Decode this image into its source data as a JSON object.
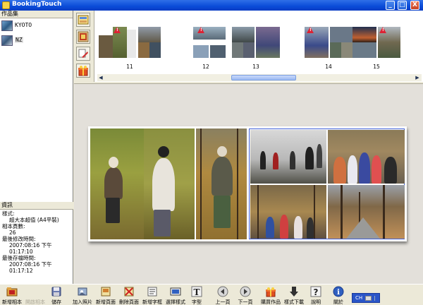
{
  "window": {
    "title": "BookingTouch",
    "minimize": "_",
    "maximize": "□",
    "close": "X"
  },
  "albums_panel": {
    "header": "作品集",
    "items": [
      {
        "name": "KYOTO",
        "selected": false
      },
      {
        "name": "NZ",
        "selected": true
      }
    ]
  },
  "info_panel": {
    "header": "資訊",
    "style_label": "樣式:",
    "style_value": "超大本超值 (A4平裝)",
    "pages_label": "相本頁數:",
    "pages_value": "26",
    "modified_label": "最後修改時間:",
    "modified_value": "2007:08:16 下午 01:17:10",
    "saved_label": "最後存檔時間:",
    "saved_value": "2007:08:16 下午 01:17:12"
  },
  "side_tools": [
    "layout-icon",
    "background-icon",
    "eraser-icon",
    "gift-icon"
  ],
  "thumbnails": [
    {
      "page": "11",
      "warning": true
    },
    {
      "page": "12",
      "warning": true
    },
    {
      "page": "13",
      "warning": false
    },
    {
      "page": "14",
      "warning": true
    },
    {
      "page": "15",
      "warning": true
    }
  ],
  "toolbar": [
    {
      "label": "新增相本",
      "icon": "folder-icon",
      "enabled": true
    },
    {
      "label": "開啟相本",
      "icon": "open-folder-icon",
      "enabled": false
    },
    {
      "label": "儲存",
      "icon": "save-icon",
      "enabled": true
    },
    {
      "label": "加入照片",
      "icon": "add-photo-icon",
      "enabled": true
    },
    {
      "label": "新增頁面",
      "icon": "add-page-icon",
      "enabled": true
    },
    {
      "label": "刪除頁面",
      "icon": "delete-page-icon",
      "enabled": true
    },
    {
      "label": "新增字框",
      "icon": "add-textbox-icon",
      "enabled": true
    },
    {
      "label": "選擇樣式",
      "icon": "style-icon",
      "enabled": true
    },
    {
      "label": "字型",
      "icon": "font-icon",
      "enabled": true
    },
    {
      "label": "上一頁",
      "icon": "prev-page-icon",
      "enabled": true
    },
    {
      "label": "下一頁",
      "icon": "next-page-icon",
      "enabled": true
    },
    {
      "label": "購買作品",
      "icon": "buy-gift-icon",
      "enabled": true
    },
    {
      "label": "樣式下載",
      "icon": "download-icon",
      "enabled": true
    },
    {
      "label": "說明",
      "icon": "help-icon",
      "enabled": true
    },
    {
      "label": "關於",
      "icon": "about-icon",
      "enabled": true
    }
  ],
  "language": {
    "code": "CH"
  },
  "colors": {
    "titlebar": "#0a4bd8",
    "selection": "#4060d8",
    "warning": "#dd2233"
  }
}
